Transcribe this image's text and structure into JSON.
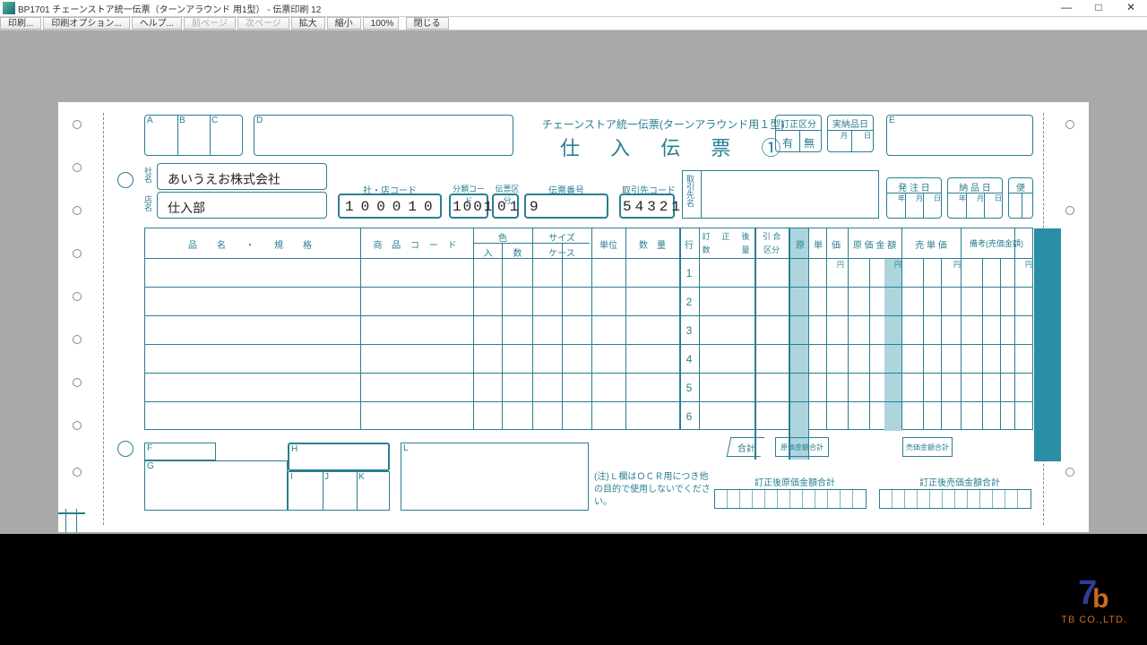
{
  "window": {
    "title": "BP1701 チェーンストア統一伝票（ターンアラウンド 用1型） - 伝票印刷 12",
    "btn_min": "—",
    "btn_max": "□",
    "btn_close": "✕"
  },
  "toolbar": {
    "print": "印刷...",
    "print_opt": "印刷オプション...",
    "help": "ヘルプ...",
    "prev": "前ページ",
    "next": "次ページ",
    "zoom_in": "拡大",
    "zoom_out": "縮小",
    "zoom": "100%",
    "close": "閉じる"
  },
  "form": {
    "header_sub": "チェーンストア統一伝票(ターンアラウンド用１型)",
    "title": "仕 入 伝 票 ①",
    "correction": {
      "label": "訂正区分",
      "opt1": "有",
      "opt2": "無"
    },
    "delivery": {
      "label": "実納品日",
      "m": "月",
      "d": "日"
    },
    "company_label": "社名",
    "store_label": "店名",
    "company": "あいうえお株式会社",
    "store": "仕入部",
    "code_header": {
      "sha": "社・店コード",
      "bunrui": "分類コード",
      "denku": "伝票区分",
      "denban": "伝票番号",
      "torihiki": "取引先コード"
    },
    "values": {
      "sha": "100010",
      "bunrui": "1001",
      "denku": "01",
      "denban": "9",
      "torihiki": "54321"
    },
    "torihiki_label": "取引先名",
    "order_date": "発 注 日",
    "deliver_date": "納 品 日",
    "bin": "便",
    "ymd": {
      "y": "年",
      "m": "月",
      "d": "日"
    },
    "cols": {
      "name": "品　名　・　規　格",
      "code": "商 品 コ ー ド",
      "color": "色",
      "colorn": "入",
      "colork": "数",
      "size": "サイズ",
      "case": "ケース",
      "unit": "単位",
      "qty": "数　量",
      "row": "行",
      "teisei": "訂　正　後",
      "teisei2": "数　　　量",
      "hiki": "引 合",
      "hikik": "区分",
      "gentan": "原　単　価",
      "genkin": "原 価 金 額",
      "uritan": "売 単 価",
      "biko": "備考(売価金額)"
    },
    "rows": [
      "1",
      "2",
      "3",
      "4",
      "5",
      "6"
    ],
    "yen": "円",
    "totals": {
      "go": "合計",
      "gentotal": "原価金額合計",
      "uritotal": "売価金額合計",
      "tei_gen": "訂正後原価金額合計",
      "tei_uri": "訂正後売価金額合計"
    },
    "note": "(注) L 欄はＯＣＲ用につき他の目的で使用しないでください。",
    "tags": {
      "A": "A",
      "B": "B",
      "C": "C",
      "D": "D",
      "E": "E",
      "F": "F",
      "G": "G",
      "H": "H",
      "I": "I",
      "J": "J",
      "K": "K",
      "L": "L"
    }
  },
  "brand": {
    "name": "TB CO.,LTD."
  }
}
